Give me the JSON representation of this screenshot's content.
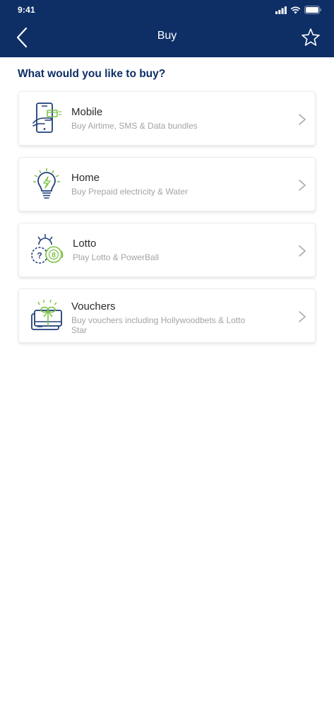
{
  "status_bar": {
    "time": "9:41"
  },
  "header": {
    "title": "Buy",
    "back_icon": "chevron-left-icon",
    "favorite_icon": "star-outline-icon"
  },
  "question": "What would you like to buy?",
  "items": [
    {
      "title": "Mobile",
      "subtitle": "Buy Airtime, SMS & Data bundles",
      "icon": "mobile-payment-icon"
    },
    {
      "title": "Home",
      "subtitle": "Buy Prepaid electricity & Water",
      "icon": "lightbulb-icon"
    },
    {
      "title": "Lotto",
      "subtitle": "Play Lotto & PowerBall",
      "icon": "lotto-balls-icon"
    },
    {
      "title": "Vouchers",
      "subtitle": "Buy vouchers including Hollywoodbets & Lotto Star",
      "icon": "gift-voucher-icon"
    }
  ],
  "colors": {
    "header_bg": "#0e2f66",
    "accent_green": "#7ac143",
    "icon_navy": "#1f3f7a",
    "subtitle_gray": "#a4a4a4"
  }
}
